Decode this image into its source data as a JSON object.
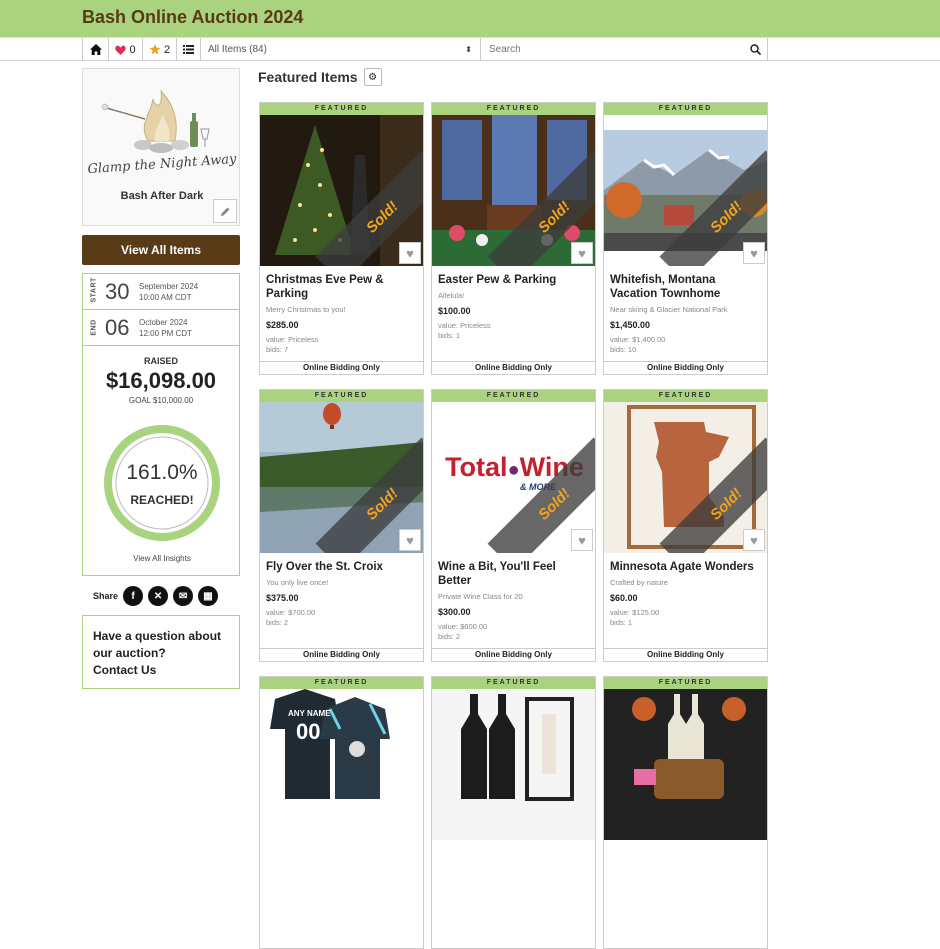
{
  "app": {
    "title": "Bash Online Auction 2024"
  },
  "nav": {
    "favorites_count": "0",
    "starred_count": "2",
    "filter_selected": "All Items (84)",
    "search_placeholder": "Search"
  },
  "sidebar": {
    "logo_script": "Glamp the Night Away",
    "logo_subtitle": "Bash After Dark",
    "view_all_label": "View All Items",
    "start": {
      "label": "START",
      "day": "30",
      "month_year": "September 2024",
      "time": "10:00 AM CDT"
    },
    "end": {
      "label": "END",
      "day": "06",
      "month_year": "October 2024",
      "time": "12:00 PM CDT"
    },
    "raised_label": "RAISED",
    "raised_amount": "$16,098.00",
    "goal": "GOAL $10,000.00",
    "percent": "161.0%",
    "reached": "REACHED!",
    "progress_fraction": 1.0,
    "insights_link": "View All Insights",
    "share_label": "Share",
    "question_line1": "Have a question about",
    "question_line2": "our auction?",
    "contact": "Contact Us"
  },
  "main": {
    "heading": "Featured Items",
    "featured_tag": "FEATURED",
    "sold_label": "Sold!",
    "items": [
      {
        "title": "Christmas Eve Pew & Parking",
        "subtitle": "Merry Christmas to you!",
        "price": "$285.00",
        "value": "value: Priceless",
        "bids": "bids: 7",
        "footer": "Online Bidding Only"
      },
      {
        "title": "Easter Pew & Parking",
        "subtitle": "Allelula!",
        "price": "$100.00",
        "value": "value: Priceless",
        "bids": "bids: 1",
        "footer": "Online Bidding Only"
      },
      {
        "title": "Whitefish, Montana Vacation Townhome",
        "subtitle": "Near skiing & Glacier National Park",
        "price": "$1,450.00",
        "value": "value: $1,400.00",
        "bids": "bids: 10",
        "footer": "Online Bidding Only"
      },
      {
        "title": "Fly Over the St. Croix",
        "subtitle": "You only live once!",
        "price": "$375.00",
        "value": "value: $700.00",
        "bids": "bids: 2",
        "footer": "Online Bidding Only"
      },
      {
        "title": "Wine a Bit, You'll Feel Better",
        "subtitle": "Private Wine Class for 20",
        "price": "$300.00",
        "value": "value: $600.00",
        "bids": "bids: 2",
        "footer": "Online Bidding Only"
      },
      {
        "title": "Minnesota Agate Wonders",
        "subtitle": "Crafted by nature",
        "price": "$60.00",
        "value": "value: $125.00",
        "bids": "bids: 1",
        "footer": "Online Bidding Only"
      }
    ],
    "totalwine_text1": "Total",
    "totalwine_text2": "Wine",
    "totalwine_text3": "& MORE",
    "jersey_name": "ANY NAME",
    "jersey_number": "00"
  }
}
